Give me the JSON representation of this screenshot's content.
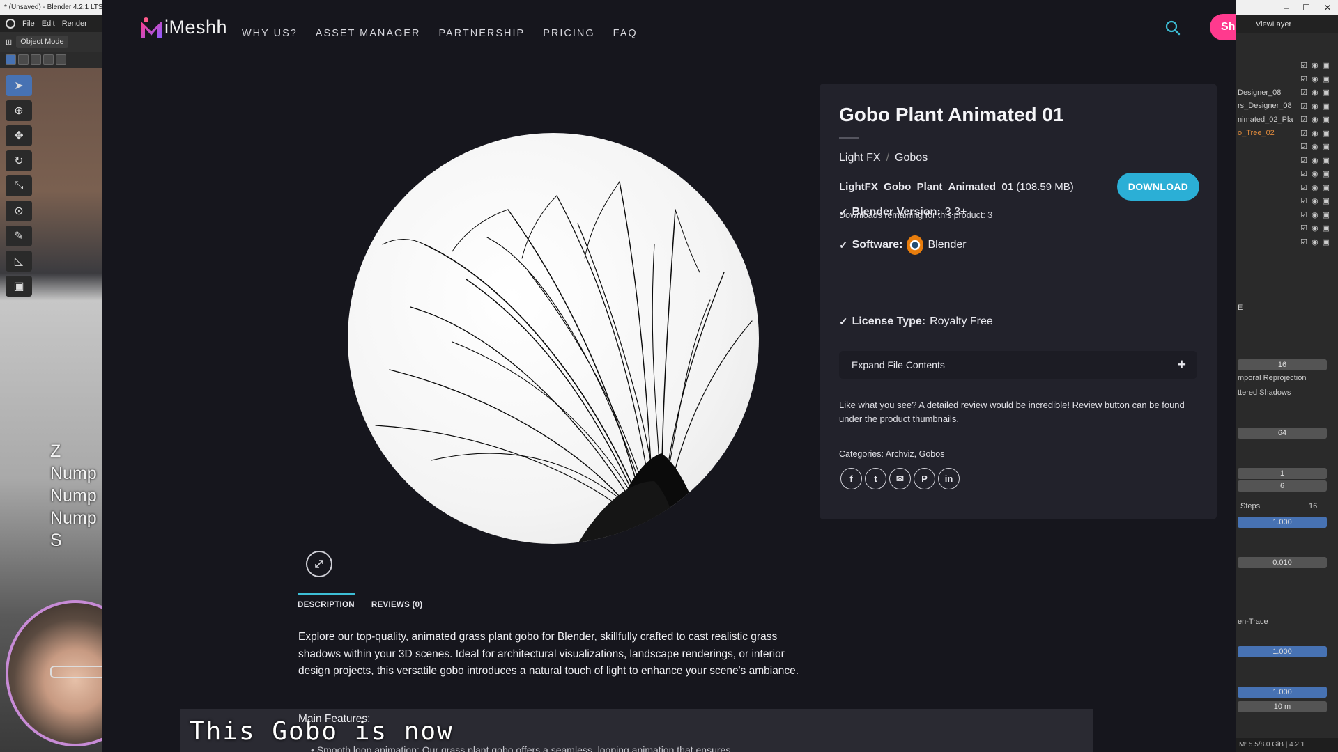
{
  "blender": {
    "window_title": "* (Unsaved) - Blender 4.2.1 LTS",
    "menu": [
      "File",
      "Edit",
      "Render"
    ],
    "mode": "Object Mode",
    "key_overlay": [
      "Z",
      "Nump",
      "Nump",
      "Nump",
      "S"
    ],
    "right": {
      "view_layer": "ViewLayer",
      "outliner_items": [
        {
          "name": "",
          "active": false
        },
        {
          "name": "",
          "active": false
        },
        {
          "name": "Designer_08",
          "active": false
        },
        {
          "name": "rs_Designer_08",
          "active": false
        },
        {
          "name": "nimated_02_Pla",
          "active": false
        },
        {
          "name": "o_Tree_02",
          "active": true
        },
        {
          "name": "",
          "active": false
        },
        {
          "name": "",
          "active": false
        },
        {
          "name": "",
          "active": false
        },
        {
          "name": "",
          "active": false
        },
        {
          "name": "",
          "active": false
        },
        {
          "name": "",
          "active": false
        },
        {
          "name": "",
          "active": false
        },
        {
          "name": "",
          "active": false
        }
      ],
      "render_engine": "E",
      "fields": {
        "samples": "16",
        "temporal": "mporal Reprojection",
        "jittered": "ttered Shadows",
        "resolution": "64",
        "f1": "1",
        "f2": "6",
        "steps_label": "Steps",
        "steps_value": "16",
        "f3": "1.000",
        "f4": "0.010",
        "method": "en-Trace",
        "f5": "1.000",
        "f6": "1.000",
        "f7": "10 m"
      },
      "status": "M: 5.5/8.0 GiB | 4.2.1"
    }
  },
  "site": {
    "logo_text": "iMeshh",
    "nav": [
      "WHY US?",
      "ASSET MANAGER",
      "PARTNERSHIP",
      "PRICING",
      "FAQ"
    ],
    "share_label": "Sh",
    "product": {
      "title": "Gobo Plant Animated 01",
      "breadcrumb": [
        "Light FX",
        "Gobos"
      ],
      "breadcrumb_sep": "/",
      "file_name": "LightFX_Gobo_Plant_Animated_01",
      "file_size": " (108.59 MB)",
      "download_label": "DOWNLOAD",
      "downloads_remaining": "Downloads remaining for this product: 3",
      "specs": [
        {
          "label": "Blender Version:",
          "value": "3.3+"
        },
        {
          "label": "Software:",
          "value": "Blender"
        },
        {
          "label": "License Type:",
          "value": "Royalty Free"
        }
      ],
      "expand_label": "Expand File Contents",
      "expand_icon": "+",
      "review_note": "Like what you see? A detailed review would be incredible! Review button can be found under the product thumbnails.",
      "categories": "Categories: Archviz, Gobos",
      "share_icons": [
        "facebook-icon",
        "twitter-icon",
        "email-icon",
        "pinterest-icon",
        "linkedin-icon"
      ],
      "share_glyphs": [
        "f",
        "t",
        "✉",
        "P",
        "in"
      ]
    },
    "tabs": [
      {
        "label": "DESCRIPTION",
        "active": true
      },
      {
        "label": "REVIEWS (0)",
        "active": false
      }
    ],
    "description": "Explore our top-quality, animated grass plant gobo for Blender, skillfully crafted to cast realistic grass shadows within your 3D scenes. Ideal for architectural visualizations, landscape renderings, or interior design projects, this versatile gobo introduces a natural touch of light to enhance your scene's ambiance.",
    "features_title": "Main Features:",
    "feature_1": "• Smooth loop animation: Our grass plant gobo offers a seamless, looping animation that ensures",
    "subtitle": "This Gobo is now"
  },
  "colors": {
    "accent": "#2bafd6",
    "tab_accent": "#3dbed6",
    "brand_pink": "#ff3a8e",
    "card_bg": "#22222b",
    "page_bg": "#16161d"
  }
}
